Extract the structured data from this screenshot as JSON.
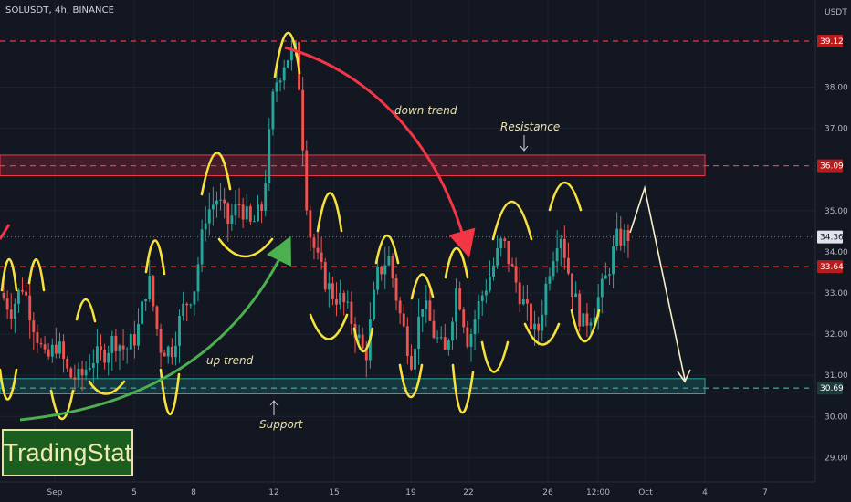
{
  "header": {
    "symbol_line": "SOLUSDT, 4h, BINANCE",
    "currency": "USDT"
  },
  "watermark": "TradingStat",
  "chart_data": {
    "type": "candlestick",
    "symbol": "SOLUSDT",
    "interval": "4h",
    "exchange": "BINANCE",
    "ylim": [
      28.4,
      39.8
    ],
    "y_ticks": [
      29,
      30,
      31,
      32,
      33,
      35,
      37,
      38
    ],
    "x_ticks": [
      "Sep",
      "5",
      "8",
      "12",
      "15",
      "19",
      "22",
      "26",
      "12:00",
      "Oct",
      "4",
      "7"
    ],
    "price_lines": [
      {
        "value": 39.12,
        "label": "39.12",
        "color": "#f23645",
        "style": "dashed"
      },
      {
        "value": 36.09,
        "label": "36.09",
        "color": "#f23645",
        "style": "dashed"
      },
      {
        "value": 33.64,
        "label": "33.64",
        "color": "#f23645",
        "style": "dashed"
      },
      {
        "value": 30.69,
        "label": "30.69",
        "color": "#26a69a",
        "style": "dashed"
      }
    ],
    "last_price": {
      "value": 34.36,
      "label": "34.36"
    },
    "extra_tick_labels": [
      "34.00",
      "36.00"
    ],
    "zones": [
      {
        "name": "resistance-zone",
        "low": 35.85,
        "high": 36.35,
        "color": "#f23645"
      },
      {
        "name": "support-zone",
        "low": 30.55,
        "high": 30.92,
        "color": "#26a69a"
      }
    ],
    "annotations": {
      "resistance": "Resistance",
      "support": "Support",
      "down_trend": "down trend",
      "up_trend": "up trend"
    },
    "colors": {
      "up": "#26a69a",
      "down": "#ef5350",
      "background": "#131722",
      "grid": "#1e2230",
      "axis_text": "#b2b5be",
      "highlight": "#f7e23d"
    },
    "price_path": [
      [
        0,
        33.0
      ],
      [
        1,
        32.6
      ],
      [
        2,
        33.2
      ],
      [
        3,
        32.2
      ],
      [
        4,
        31.3
      ],
      [
        5,
        31.8
      ],
      [
        6,
        31.0
      ],
      [
        7,
        30.9
      ],
      [
        8,
        31.4
      ],
      [
        9,
        31.5
      ],
      [
        10,
        31.9
      ],
      [
        11,
        31.6
      ],
      [
        12,
        32.0
      ],
      [
        13,
        33.4
      ],
      [
        14,
        31.7
      ],
      [
        15,
        31.6
      ],
      [
        16,
        32.6
      ],
      [
        17,
        33.1
      ],
      [
        18,
        34.9
      ],
      [
        19,
        35.3
      ],
      [
        20,
        34.7
      ],
      [
        21,
        35.2
      ],
      [
        22,
        34.6
      ],
      [
        23,
        35.1
      ],
      [
        24,
        38.0
      ],
      [
        25,
        38.7
      ],
      [
        26,
        38.9
      ],
      [
        27,
        34.6
      ],
      [
        28,
        33.6
      ],
      [
        29,
        33.0
      ],
      [
        30,
        32.8
      ],
      [
        31,
        32.2
      ],
      [
        32,
        31.4
      ],
      [
        33,
        33.4
      ],
      [
        34,
        33.9
      ],
      [
        35,
        32.5
      ],
      [
        36,
        31.4
      ],
      [
        37,
        32.8
      ],
      [
        38,
        32.0
      ],
      [
        39,
        31.5
      ],
      [
        40,
        33.2
      ],
      [
        41,
        31.8
      ],
      [
        42,
        32.8
      ],
      [
        43,
        33.5
      ],
      [
        44,
        34.3
      ],
      [
        45,
        33.4
      ],
      [
        46,
        32.6
      ],
      [
        47,
        31.9
      ],
      [
        48,
        33.5
      ],
      [
        49,
        34.6
      ],
      [
        50,
        33.2
      ],
      [
        51,
        32.2
      ],
      [
        52,
        32.6
      ],
      [
        53,
        33.3
      ],
      [
        54,
        34.3
      ],
      [
        55,
        34.4
      ]
    ]
  }
}
